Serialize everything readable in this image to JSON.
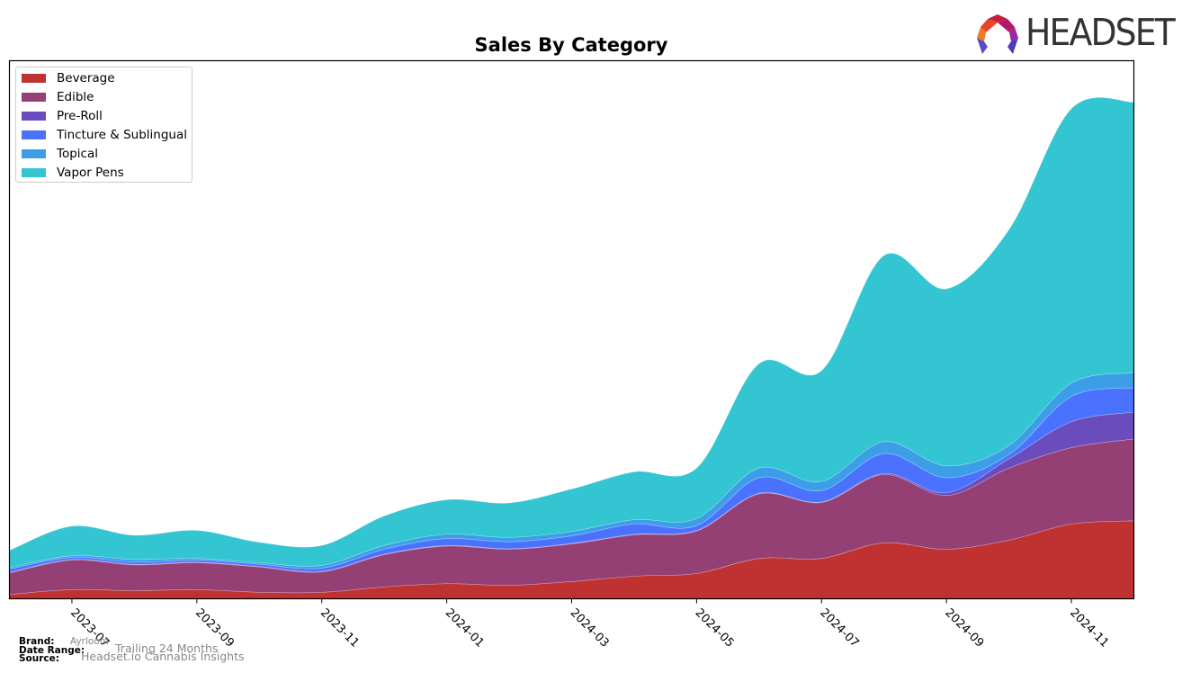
{
  "header": {
    "logo_text": "HEADSET"
  },
  "chart_data": {
    "type": "area",
    "stacked": true,
    "title": "Sales By Category",
    "xlabel": "",
    "ylabel": "",
    "x": [
      "2023-06",
      "2023-07",
      "2023-08",
      "2023-09",
      "2023-10",
      "2023-11",
      "2023-12",
      "2024-01",
      "2024-02",
      "2024-03",
      "2024-04",
      "2024-05",
      "2024-06",
      "2024-07",
      "2024-08",
      "2024-09",
      "2024-10",
      "2024-11",
      "2024-12"
    ],
    "xtick_labels": [
      "2023-07",
      "2023-09",
      "2023-11",
      "2024-01",
      "2024-03",
      "2024-05",
      "2024-07",
      "2024-09",
      "2024-11"
    ],
    "ylim": [
      0,
      100
    ],
    "y_ticks_visible": false,
    "grid": false,
    "legend_position": "top-left",
    "series": [
      {
        "name": "Beverage",
        "color": "#c03232",
        "values": [
          0.8,
          1.7,
          1.5,
          1.7,
          1.2,
          1.2,
          2.2,
          2.8,
          2.5,
          3.2,
          4.2,
          4.7,
          7.5,
          7.5,
          10.4,
          9.2,
          10.9,
          13.9,
          14.5
        ]
      },
      {
        "name": "Edible",
        "color": "#954075",
        "values": [
          4.0,
          5.5,
          4.8,
          5.0,
          4.7,
          3.8,
          6.0,
          7.0,
          6.7,
          7.0,
          7.7,
          7.9,
          12.0,
          10.4,
          12.7,
          10.0,
          13.4,
          14.2,
          15.2
        ]
      },
      {
        "name": "Pre-Roll",
        "color": "#6a4cbc",
        "values": [
          0.1,
          0.1,
          0.1,
          0.1,
          0.1,
          0.1,
          0.1,
          0.1,
          0.1,
          0.1,
          0.1,
          0.1,
          0.1,
          0.1,
          0.2,
          0.5,
          1.7,
          4.8,
          5.0
        ]
      },
      {
        "name": "Tincture & Sublingual",
        "color": "#4a72ff",
        "values": [
          0.6,
          0.4,
          0.4,
          0.4,
          0.4,
          0.6,
          0.9,
          1.3,
          1.3,
          1.4,
          1.9,
          0.9,
          2.9,
          2.1,
          3.7,
          2.8,
          0.8,
          4.7,
          4.5
        ]
      },
      {
        "name": "Topical",
        "color": "#3b9ee6",
        "values": [
          0.3,
          0.3,
          0.5,
          0.3,
          0.3,
          0.5,
          0.7,
          0.8,
          0.8,
          0.8,
          0.8,
          1.3,
          1.8,
          1.7,
          2.2,
          2.2,
          1.7,
          2.5,
          2.8
        ]
      },
      {
        "name": "Vapor Pens",
        "color": "#33c5d2",
        "values": [
          3.2,
          5.5,
          4.5,
          5.2,
          3.8,
          3.7,
          5.5,
          6.4,
          6.4,
          7.9,
          8.9,
          9.4,
          19.4,
          20.6,
          34.6,
          32.9,
          40.1,
          51.0,
          50.3
        ]
      }
    ]
  },
  "footer": {
    "brand_label": "Brand:",
    "brand_value": "Ayrloom",
    "date_range_label": "Date Range:",
    "date_range_value": "Trailing 24 Months",
    "source_label": "Source:",
    "source_value": "Headset.io Cannabis Insights"
  }
}
